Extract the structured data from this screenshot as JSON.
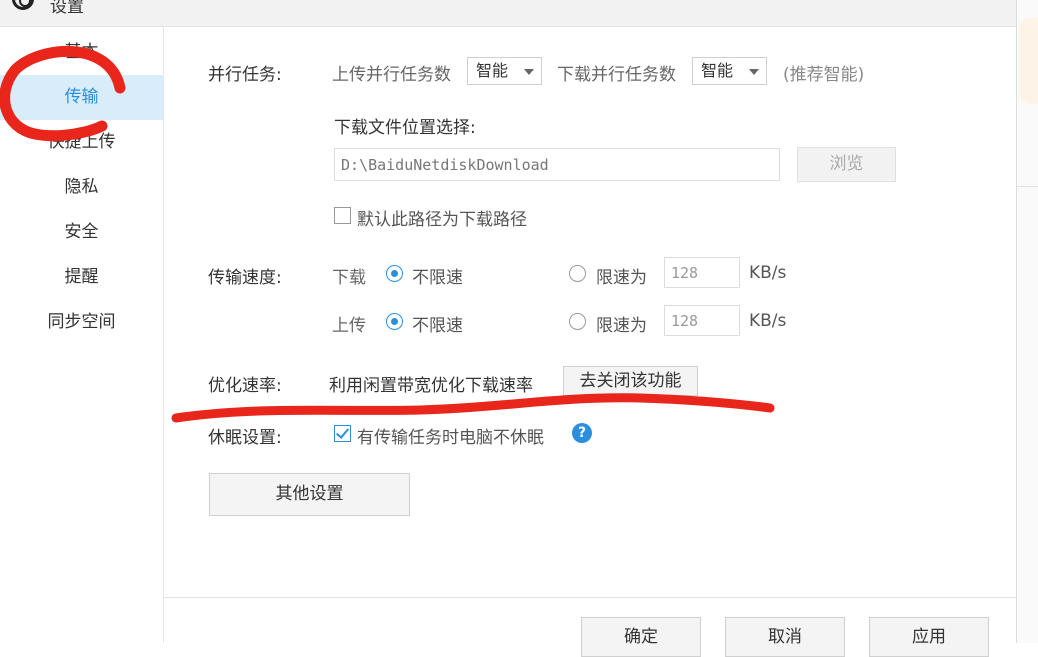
{
  "window": {
    "title": "设置"
  },
  "sidebar": {
    "items": [
      {
        "label": "基本"
      },
      {
        "label": "传输"
      },
      {
        "label": "快捷上传"
      },
      {
        "label": "隐私"
      },
      {
        "label": "安全"
      },
      {
        "label": "提醒"
      },
      {
        "label": "同步空间"
      }
    ],
    "active": "传输"
  },
  "transfer": {
    "parallel": {
      "label": "并行任务:",
      "upload_label": "上传并行任务数",
      "upload_value": "智能",
      "download_label": "下载并行任务数",
      "download_value": "智能",
      "hint": "(推荐智能)"
    },
    "location": {
      "label": "下载文件位置选择:",
      "path": "D:\\BaiduNetdiskDownload",
      "browse": "浏览",
      "default_label": "默认此路径为下载路径",
      "default_checked": false
    },
    "speed": {
      "label": "传输速度:",
      "download": {
        "label": "下载",
        "unlimited": "不限速",
        "limit": "限速为",
        "value": "128",
        "unit": "KB/s",
        "selected": "unlimited"
      },
      "upload": {
        "label": "上传",
        "unlimited": "不限速",
        "limit": "限速为",
        "value": "128",
        "unit": "KB/s",
        "selected": "unlimited"
      }
    },
    "optimize": {
      "label": "优化速率:",
      "text": "利用闲置带宽优化下载速率",
      "button": "去关闭该功能"
    },
    "sleep": {
      "label": "休眠设置:",
      "option": "有传输任务时电脑不休眠",
      "checked": true
    },
    "other_button": "其他设置"
  },
  "footer": {
    "ok": "确定",
    "cancel": "取消",
    "apply": "应用"
  },
  "colors": {
    "accent": "#2b8fdd",
    "annotation": "#e8261c",
    "active_bg": "#d9ecfa"
  }
}
